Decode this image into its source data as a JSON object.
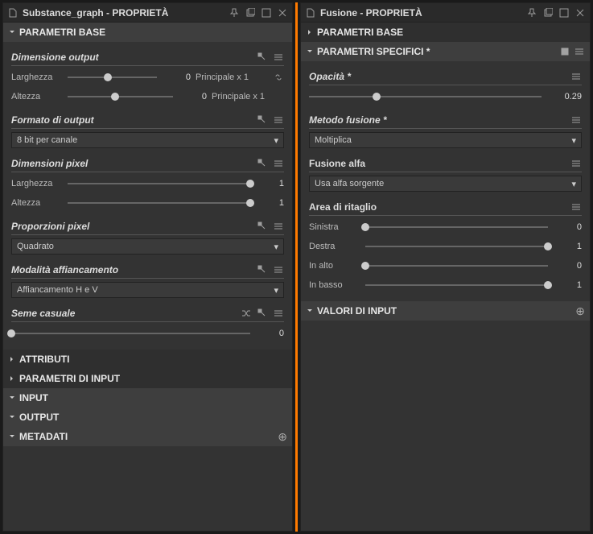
{
  "left": {
    "title": "Substance_graph - PROPRIETÀ",
    "section_base": "PARAMETRI BASE",
    "dim_output": {
      "title": "Dimensione output",
      "width_label": "Larghezza",
      "width_val": "0",
      "width_link": "Principale x 1",
      "height_label": "Altezza",
      "height_val": "0",
      "height_link": "Principale x 1"
    },
    "format": {
      "title": "Formato di output",
      "value": "8 bit per canale"
    },
    "dim_pixel": {
      "title": "Dimensioni pixel",
      "width_label": "Larghezza",
      "width_val": "1",
      "height_label": "Altezza",
      "height_val": "1"
    },
    "prop_pixel": {
      "title": "Proporzioni pixel",
      "value": "Quadrato"
    },
    "tiling": {
      "title": "Modalità affiancamento",
      "value": "Affiancamento H e V"
    },
    "seed": {
      "title": "Seme casuale",
      "val": "0"
    },
    "sections": {
      "attributi": "ATTRIBUTI",
      "param_input": "PARAMETRI DI INPUT",
      "input": "INPUT",
      "output": "OUTPUT",
      "metadati": "METADATI"
    }
  },
  "right": {
    "title": "Fusione - PROPRIETÀ",
    "section_base": "PARAMETRI BASE",
    "section_specific": "PARAMETRI SPECIFICI *",
    "opacity": {
      "title": "Opacità *",
      "val": "0.29"
    },
    "blend_method": {
      "title": "Metodo fusione *",
      "value": "Moltiplica"
    },
    "alpha": {
      "title": "Fusione alfa",
      "value": "Usa alfa sorgente"
    },
    "crop": {
      "title": "Area di ritaglio",
      "left_label": "Sinistra",
      "left_val": "0",
      "right_label": "Destra",
      "right_val": "1",
      "top_label": "In alto",
      "top_val": "0",
      "bottom_label": "In basso",
      "bottom_val": "1"
    },
    "section_values": "VALORI DI INPUT"
  }
}
